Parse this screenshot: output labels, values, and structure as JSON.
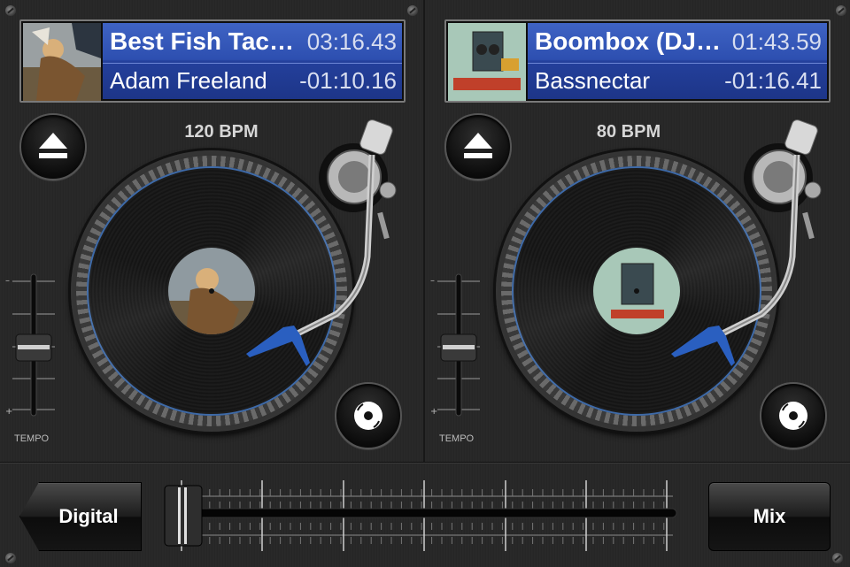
{
  "decks": [
    {
      "title": "Best Fish Tac…",
      "artist": "Adam Freeland",
      "elapsed": "03:16.43",
      "remaining": "-01:10.16",
      "bpm": "120 BPM",
      "tempo_label": "TEMPO",
      "tempo_fraction": 0.5
    },
    {
      "title": "Boombox (DJ…",
      "artist": "Bassnectar",
      "elapsed": "01:43.59",
      "remaining": "-01:16.41",
      "bpm": "80 BPM",
      "tempo_label": "TEMPO",
      "tempo_fraction": 0.5
    }
  ],
  "bottom": {
    "digital_label": "Digital",
    "mix_label": "Mix",
    "crossfader_fraction": 0.0
  },
  "colors": {
    "panel_blue": "#2d4fb0",
    "stylus_blue": "#2a5fc0"
  }
}
